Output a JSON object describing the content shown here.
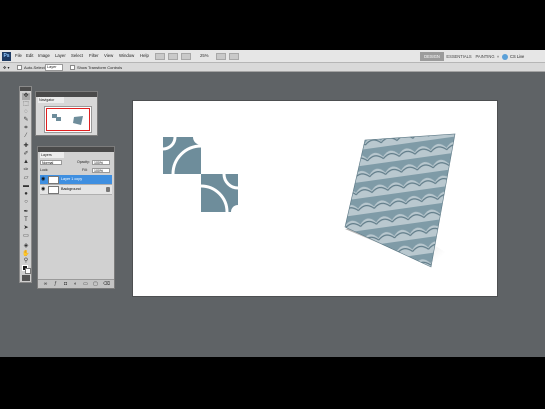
{
  "menubar": {
    "logo": "Ps",
    "items": [
      "File",
      "Edit",
      "Image",
      "Layer",
      "Select",
      "Filter",
      "View",
      "Window",
      "Help"
    ],
    "zoom": "25%",
    "workspaces": [
      "DESIGN",
      "ESSENTIALS",
      "PAINTING",
      "»"
    ],
    "cs_live": "CS Live"
  },
  "options": {
    "auto_select_label": "Auto-Select:",
    "auto_select_value": "Layer",
    "transform_controls_label": "Show Transform Controls"
  },
  "panels": {
    "navigator_tab": "Navigator",
    "layers_tab": "Layers",
    "blend_mode": "Normal",
    "opacity_label": "Opacity:",
    "opacity_value": "100%",
    "lock_label": "Lock:",
    "fill_label": "Fill:",
    "fill_value": "100%",
    "layers": [
      {
        "name": "Layer 1 copy",
        "selected": true
      },
      {
        "name": "Background",
        "selected": false
      }
    ]
  },
  "colors": {
    "tile": "#6e8d9b",
    "accent": "#3f8fe0"
  }
}
